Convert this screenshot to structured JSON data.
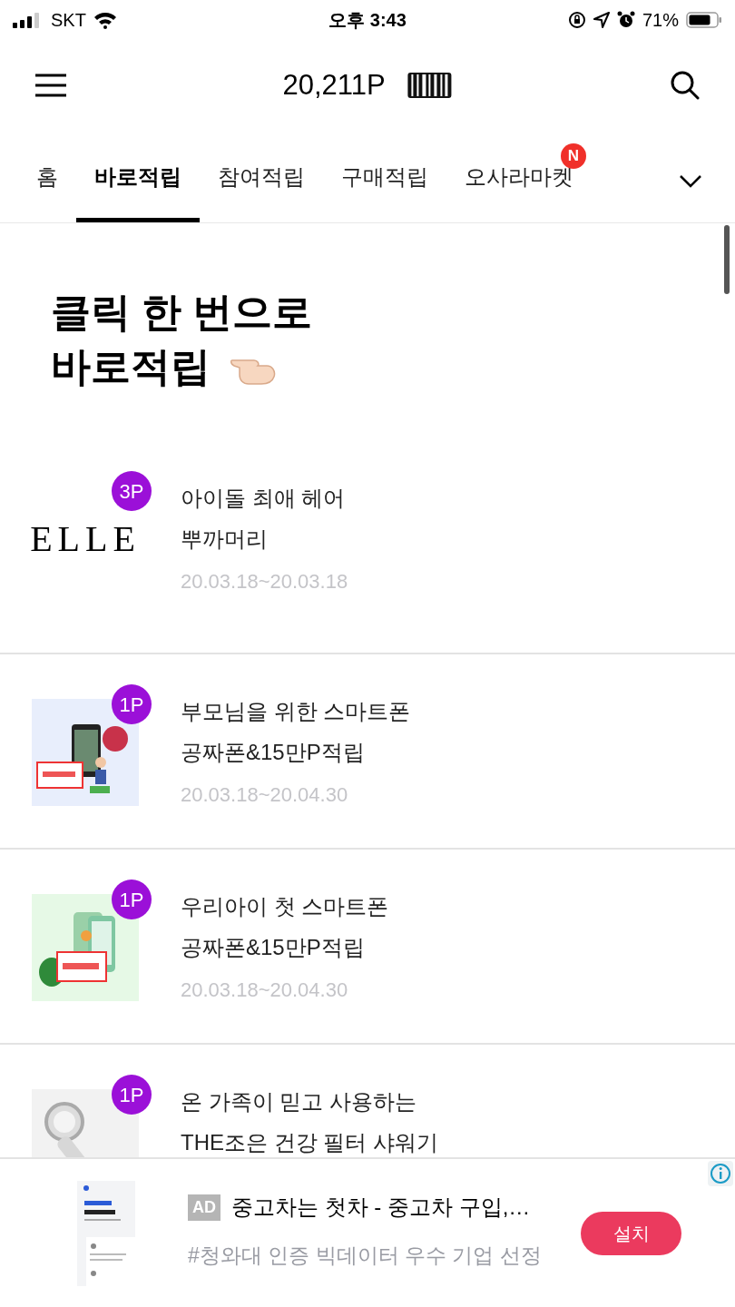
{
  "status_bar": {
    "carrier": "SKT",
    "time": "오후 3:43",
    "battery": "71%"
  },
  "header": {
    "points": "20,211P"
  },
  "tabs": [
    {
      "label": "홈",
      "selected": false
    },
    {
      "label": "바로적립",
      "selected": true
    },
    {
      "label": "참여적립",
      "selected": false
    },
    {
      "label": "구매적립",
      "selected": false
    },
    {
      "label": "오사라마켓",
      "selected": false,
      "badge": "N"
    }
  ],
  "headline": [
    "클릭 한 번으로",
    "바로적립"
  ],
  "items": [
    {
      "kind": "logo",
      "logo_text": "ELLE",
      "points": "3P",
      "title": [
        "아이돌 최애 헤어",
        "뿌까머리"
      ],
      "period": "20.03.18~20.03.18"
    },
    {
      "kind": "picture",
      "points": "1P",
      "title": [
        "부모님을 위한 스마트폰",
        "공짜폰&15만P적립"
      ],
      "period": "20.03.18~20.04.30"
    },
    {
      "kind": "picture",
      "points": "1P",
      "title": [
        "우리아이 첫 스마트폰",
        "공짜폰&15만P적립"
      ],
      "period": "20.03.18~20.04.30"
    },
    {
      "kind": "picture",
      "points": "1P",
      "title": [
        "온 가족이 믿고 사용하는",
        "THE조은 건강 필터 샤워기"
      ]
    }
  ],
  "ad": {
    "tag": "AD",
    "title": "중고차는 첫차 - 중고차 구입,…",
    "subtitle": "#청와대 인증 빅데이터 우수 기업 선정",
    "button": "설치"
  }
}
